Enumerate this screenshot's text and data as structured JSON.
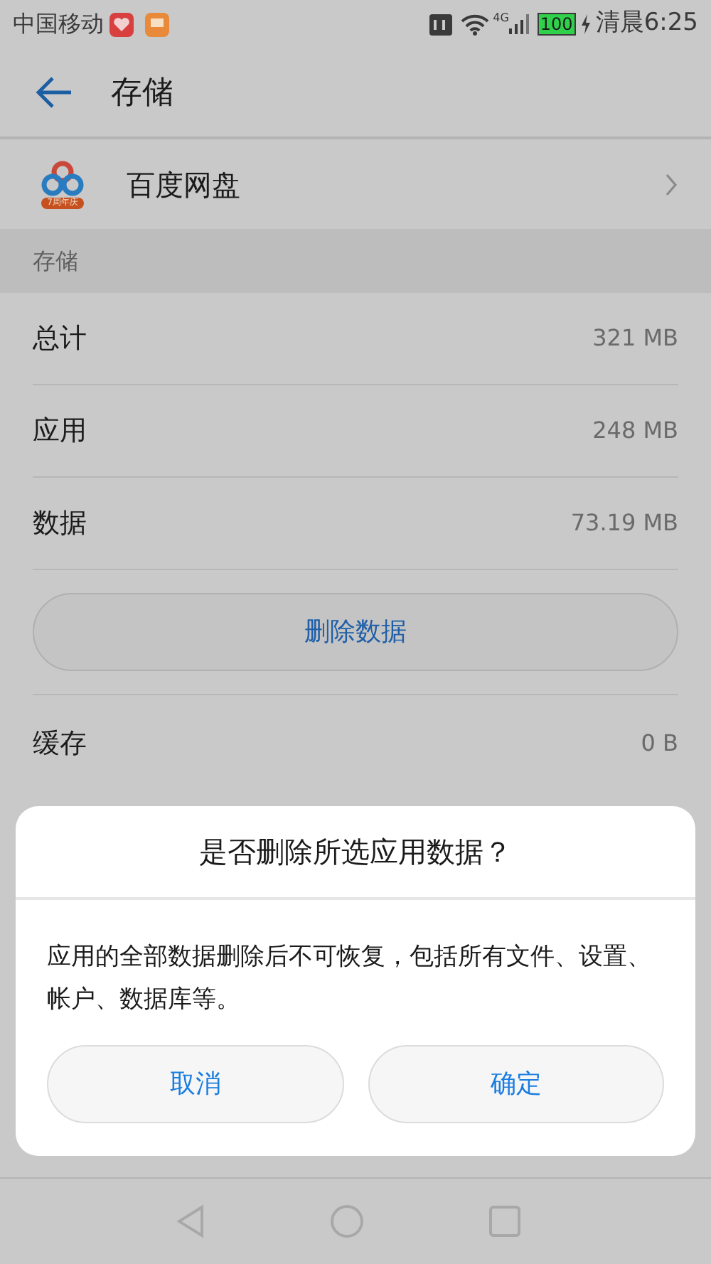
{
  "status_bar": {
    "carrier": "中国移动",
    "network": "4G",
    "battery": "100",
    "time": "清晨6:25"
  },
  "header": {
    "title": "存储"
  },
  "app": {
    "name": "百度网盘",
    "badge": "7周年庆"
  },
  "section": {
    "title": "存储"
  },
  "rows": [
    {
      "label": "总计",
      "value": "321 MB"
    },
    {
      "label": "应用",
      "value": "248 MB"
    },
    {
      "label": "数据",
      "value": "73.19 MB"
    }
  ],
  "clear_button": "删除数据",
  "cache": {
    "label": "缓存",
    "value": "0 B"
  },
  "dialog": {
    "title": "是否删除所选应用数据？",
    "message": "应用的全部数据删除后不可恢复，包括所有文件、设置、帐户、数据库等。",
    "buttons": [
      "取消",
      "确定"
    ]
  }
}
